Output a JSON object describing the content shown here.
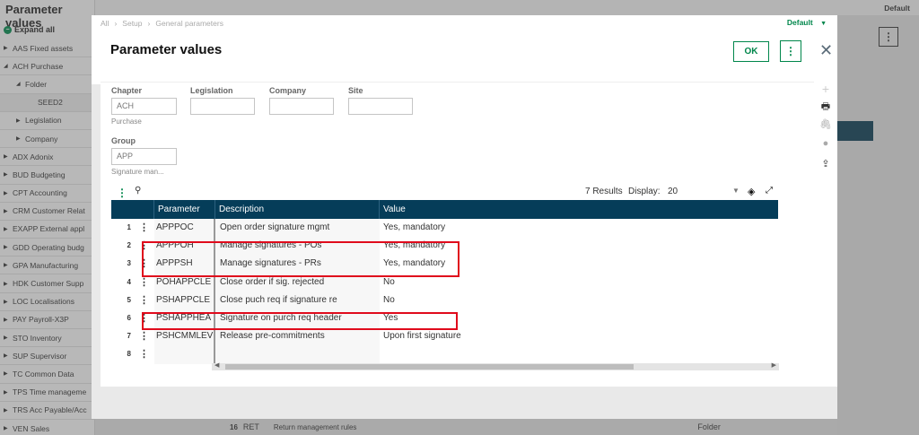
{
  "background": {
    "title": "Parameter values",
    "expand_all": "Expand all",
    "breadcrumb": [
      "All",
      "Setup",
      "General parameters"
    ],
    "default_label": "Default",
    "tree": [
      {
        "label": "AAS Fixed assets",
        "arrow": "▶",
        "indent": 0
      },
      {
        "label": "ACH Purchase",
        "arrow": "◢",
        "indent": 0
      },
      {
        "label": "Folder",
        "arrow": "◢",
        "indent": 1
      },
      {
        "label": "SEED2",
        "arrow": "",
        "indent": 2
      },
      {
        "label": "Legislation",
        "arrow": "▶",
        "indent": 1
      },
      {
        "label": "Company",
        "arrow": "▶",
        "indent": 1
      },
      {
        "label": "ADX Adonix",
        "arrow": "▶",
        "indent": 0
      },
      {
        "label": "BUD Budgeting",
        "arrow": "▶",
        "indent": 0
      },
      {
        "label": "CPT Accounting",
        "arrow": "▶",
        "indent": 0
      },
      {
        "label": "CRM Customer Relat",
        "arrow": "▶",
        "indent": 0
      },
      {
        "label": "EXAPP External appl",
        "arrow": "▶",
        "indent": 0
      },
      {
        "label": "GDD Operating budg",
        "arrow": "▶",
        "indent": 0
      },
      {
        "label": "GPA Manufacturing",
        "arrow": "▶",
        "indent": 0
      },
      {
        "label": "HDK Customer Supp",
        "arrow": "▶",
        "indent": 0
      },
      {
        "label": "LOC Localisations",
        "arrow": "▶",
        "indent": 0
      },
      {
        "label": "PAY Payroll-X3P",
        "arrow": "▶",
        "indent": 0
      },
      {
        "label": "STO Inventory",
        "arrow": "▶",
        "indent": 0
      },
      {
        "label": "SUP Supervisor",
        "arrow": "▶",
        "indent": 0
      },
      {
        "label": "TC Common Data",
        "arrow": "▶",
        "indent": 0
      },
      {
        "label": "TPS Time manageme",
        "arrow": "▶",
        "indent": 0
      },
      {
        "label": "TRS Acc Payable/Acc",
        "arrow": "▶",
        "indent": 0
      },
      {
        "label": "VEN Sales",
        "arrow": "▶",
        "indent": 0
      }
    ],
    "bottom_row": {
      "num": "16",
      "code": "RET",
      "desc": "Return management rules",
      "level": "Folder"
    }
  },
  "modal": {
    "breadcrumb": [
      "All",
      "Setup",
      "General parameters"
    ],
    "default_label": "Default",
    "title": "Parameter values",
    "ok_label": "OK",
    "more_label": "⋮",
    "close_label": "✕",
    "form": {
      "chapter_label": "Chapter",
      "chapter_value": "ACH",
      "chapter_desc": "Purchase",
      "legislation_label": "Legislation",
      "legislation_value": "",
      "company_label": "Company",
      "company_value": "",
      "site_label": "Site",
      "site_value": "",
      "group_label": "Group",
      "group_value": "APP",
      "group_desc": "Signature man..."
    },
    "grid": {
      "results": "7 Results",
      "display_label": "Display:",
      "display_value": "20",
      "columns": [
        "Parameter",
        "Description",
        "Value"
      ],
      "rows": [
        {
          "num": "1",
          "parameter": "APPPOC",
          "description": "Open order signature mgmt",
          "value": "Yes, mandatory"
        },
        {
          "num": "2",
          "parameter": "APPPOH",
          "description": "Manage signatures - POs",
          "value": "Yes, mandatory"
        },
        {
          "num": "3",
          "parameter": "APPPSH",
          "description": "Manage signatures - PRs",
          "value": "Yes, mandatory"
        },
        {
          "num": "4",
          "parameter": "POHAPPCLE",
          "description": "Close order if sig. rejected",
          "value": "No"
        },
        {
          "num": "5",
          "parameter": "PSHAPPCLE",
          "description": "Close puch req if signature re",
          "value": "No"
        },
        {
          "num": "6",
          "parameter": "PSHAPPHEA",
          "description": "Signature on purch req header",
          "value": "Yes"
        },
        {
          "num": "7",
          "parameter": "PSHCMMLEV",
          "description": "Release pre-commitments",
          "value": "Upon first signature"
        },
        {
          "num": "8",
          "parameter": "",
          "description": "",
          "value": ""
        }
      ]
    }
  }
}
